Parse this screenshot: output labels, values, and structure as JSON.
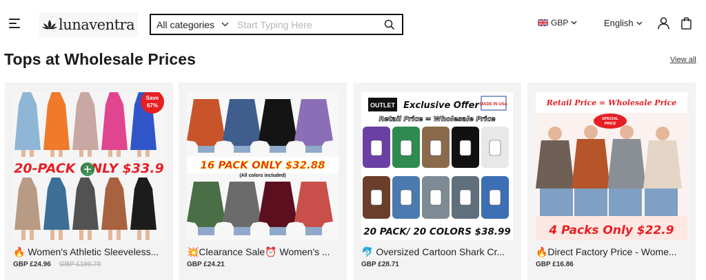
{
  "header": {
    "brand": "lunaventra",
    "search": {
      "category_label": "All categories",
      "placeholder": "Start Typing Here"
    },
    "currency": "GBP",
    "language": "English"
  },
  "section": {
    "title": "Tops at Wholesale Prices",
    "view_all": "View all"
  },
  "products": [
    {
      "name": "🔥 Women's Athletic Sleeveless...",
      "price": "GBP £24.96",
      "old_price": "GBP £190.70",
      "image_text": {
        "badge_line1": "Save",
        "badge_line2": "67%",
        "banner": "20-PACK ONLY $33.9"
      }
    },
    {
      "name": "💥Clearance Sale⏰ Women's ...",
      "price": "GBP £24.21",
      "old_price": "",
      "image_text": {
        "banner": "16 PACK ONLY $32.88",
        "sub": "(All colors included)"
      }
    },
    {
      "name": "🐬 Oversized Cartoon Shark Cr...",
      "price": "GBP £28.71",
      "old_price": "",
      "image_text": {
        "outlet": "OUTLET",
        "offer": "Exclusive Offer",
        "made": "MADE IN USA",
        "retail": "Retail Price = Wholesale Price",
        "banner": "20 PACK/ 20 COLORS $38.99"
      }
    },
    {
      "name": "🔥Direct Factory Price - Wome...",
      "price": "GBP £16.86",
      "old_price": "",
      "image_text": {
        "retail": "Retail Price = Wholesale Price",
        "special1": "SPECIAL",
        "special2": "PRICE",
        "banner": "4 Packs Only $22.9"
      }
    }
  ],
  "colors": {
    "accent_red": "#e51f23",
    "promo_blue": "#0b2a9c",
    "promo_yellow": "#ffe600",
    "card_bg": "#f3f3f3"
  }
}
